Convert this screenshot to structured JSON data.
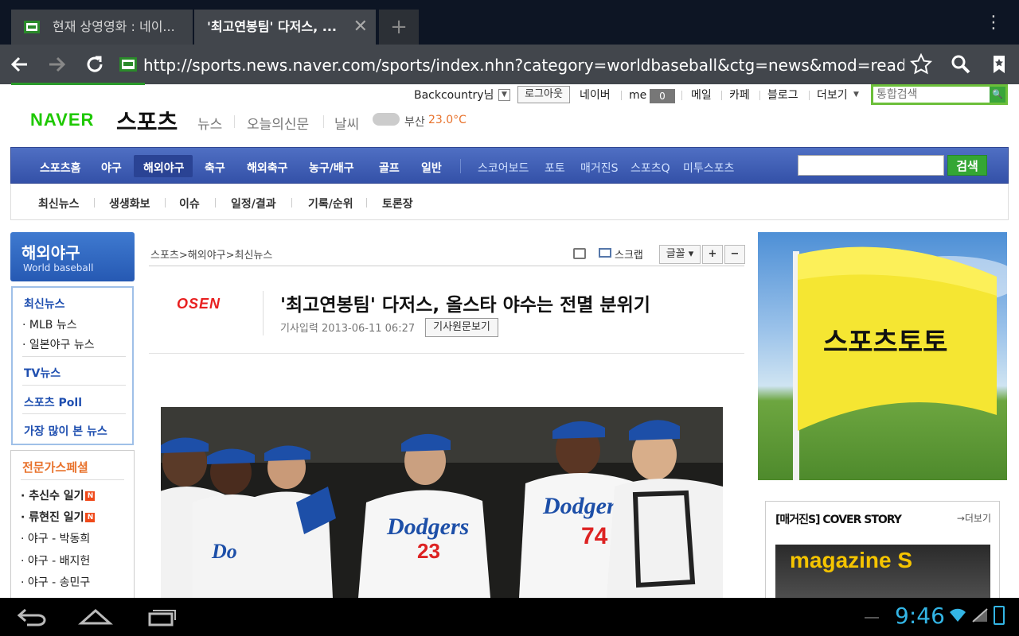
{
  "browser": {
    "tabs": [
      {
        "label": "현재 상영영화 : 네이..."
      },
      {
        "label": "'최고연봉팀' 다저스, ..."
      }
    ],
    "new_tab_label": "+",
    "url": "http://sports.news.naver.com/sports/index.nhn?category=worldbaseball&ctg=news&mod=read&office_id"
  },
  "topbar": {
    "user": "Backcountry님",
    "logout": "로그아웃",
    "links": [
      "네이버",
      "me",
      "메일",
      "카페",
      "블로그",
      "더보기"
    ],
    "me_count": "0",
    "search_placeholder": "통합검색"
  },
  "header": {
    "naver": "NAVER",
    "sports": "스포츠",
    "sublinks": [
      "뉴스",
      "오늘의신문",
      "날씨"
    ],
    "weather_city": "부산",
    "weather_temp": "23.0°C"
  },
  "mainnav": {
    "items": [
      "스포츠홈",
      "야구",
      "해외야구",
      "축구",
      "해외축구",
      "농구/배구",
      "골프",
      "일반"
    ],
    "extra": [
      "스코어보드",
      "포토",
      "매거진S",
      "스포츠Q",
      "미투스포츠"
    ],
    "search_button": "검색"
  },
  "subnav": {
    "items": [
      "최신뉴스",
      "생생화보",
      "이슈",
      "일정/결과",
      "기록/순위",
      "토론장"
    ]
  },
  "leftnav": {
    "title": "해외야구",
    "subtitle": "World baseball",
    "section1_title": "최신뉴스",
    "section1_items": [
      "MLB 뉴스",
      "일본야구 뉴스"
    ],
    "links": [
      "TV뉴스",
      "스포츠 Poll",
      "가장 많이 본 뉴스"
    ],
    "special_title": "전문가스페셜",
    "special_items": [
      "추신수 일기",
      "류현진 일기",
      "야구 - 박동희",
      "야구 - 배지헌",
      "야구 - 송민구"
    ],
    "new_badge": "N"
  },
  "article": {
    "breadcrumb": "스포츠>해외야구>최신뉴스",
    "scrap": "스크랩",
    "font": "글꼴",
    "plus": "+",
    "minus": "−",
    "source": "OSEN",
    "headline": "'최고연봉팀' 다저스, 올스타 야수는 전멸 분위기",
    "date": "기사입력 2013-06-11 06:27",
    "original": "기사원문보기",
    "jerseys": [
      "Dodgers",
      "Dodgers",
      "Dodgers"
    ],
    "numbers": [
      "23",
      "74"
    ]
  },
  "right": {
    "banner_text": "스포츠토토",
    "cover_title": "[매거진S] COVER STORY",
    "cover_more": "더보기",
    "magazine_text": "magazine S"
  },
  "system": {
    "time": "9:46"
  }
}
